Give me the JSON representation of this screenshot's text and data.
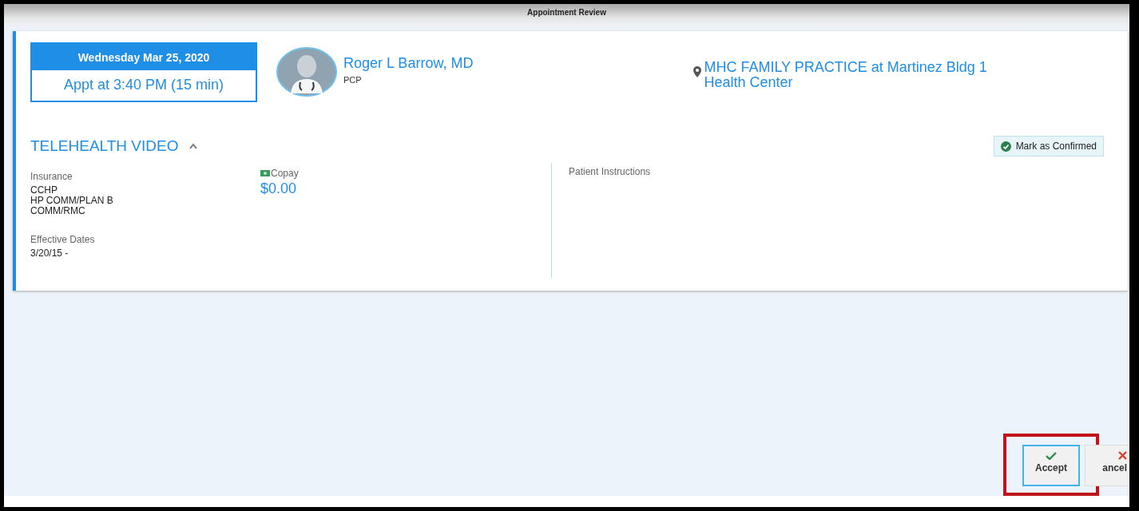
{
  "window": {
    "title": "Appointment Review"
  },
  "appointment": {
    "date": "Wednesday Mar 25, 2020",
    "time": "Appt at 3:40 PM (15 min)"
  },
  "provider": {
    "name": "Roger L Barrow, MD",
    "role": "PCP"
  },
  "location": {
    "name": "MHC FAMILY PRACTICE at Martinez Bldg 1 Health Center"
  },
  "visit": {
    "type": "TELEHEALTH VIDEO",
    "expanded": true,
    "confirm_button": "Mark as Confirmed"
  },
  "insurance": {
    "label": "Insurance",
    "lines": [
      "CCHP",
      "HP COMM/PLAN B",
      "COMM/RMC"
    ],
    "dates_label": "Effective Dates",
    "dates": "3/20/15 -"
  },
  "copay": {
    "label": "Copay",
    "amount": "$0.00"
  },
  "instructions": {
    "label": "Patient Instructions"
  },
  "buttons": [
    {
      "kind": "accept",
      "label": "Accept",
      "highlighted": true
    },
    {
      "kind": "cancel",
      "label": "ancel",
      "highlighted": false
    }
  ]
}
